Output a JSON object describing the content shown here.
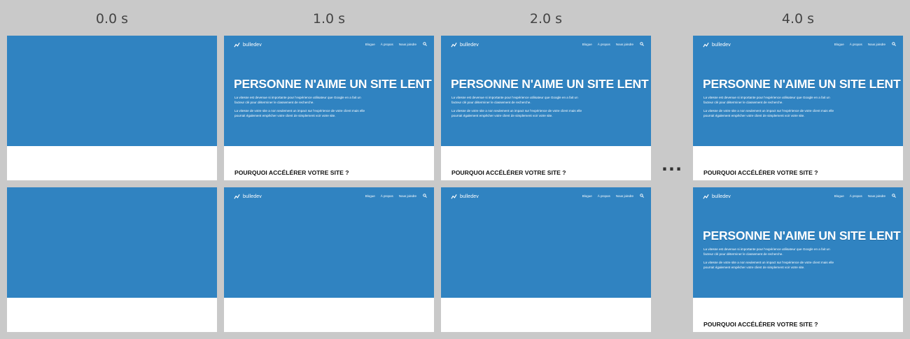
{
  "timeline": {
    "labels": [
      "0.0 s",
      "1.0 s",
      "2.0 s",
      "4.0 s"
    ],
    "ellipsis": "..."
  },
  "site": {
    "brand": "bulledev",
    "nav": [
      "Blogue",
      "À propos",
      "Nous joindre"
    ],
    "headline": "PERSONNE N'AIME UN SITE LENT",
    "para1": "La vitesse est devenue si importante pour l'expérience utilisateur que Google en a fait un facteur clé pour déterminer le classement de recherche.",
    "para2": "La vitesse de votre site a non seulement un impact sur l'expérience de votre client mais elle pourrait également empêcher votre client de simplement voir votre site.",
    "section_title": "POURQUOI ACCÉLÉRER VOTRE SITE ?"
  },
  "colors": {
    "hero_blue": "#3083c1",
    "background": "#c9c9c9"
  }
}
